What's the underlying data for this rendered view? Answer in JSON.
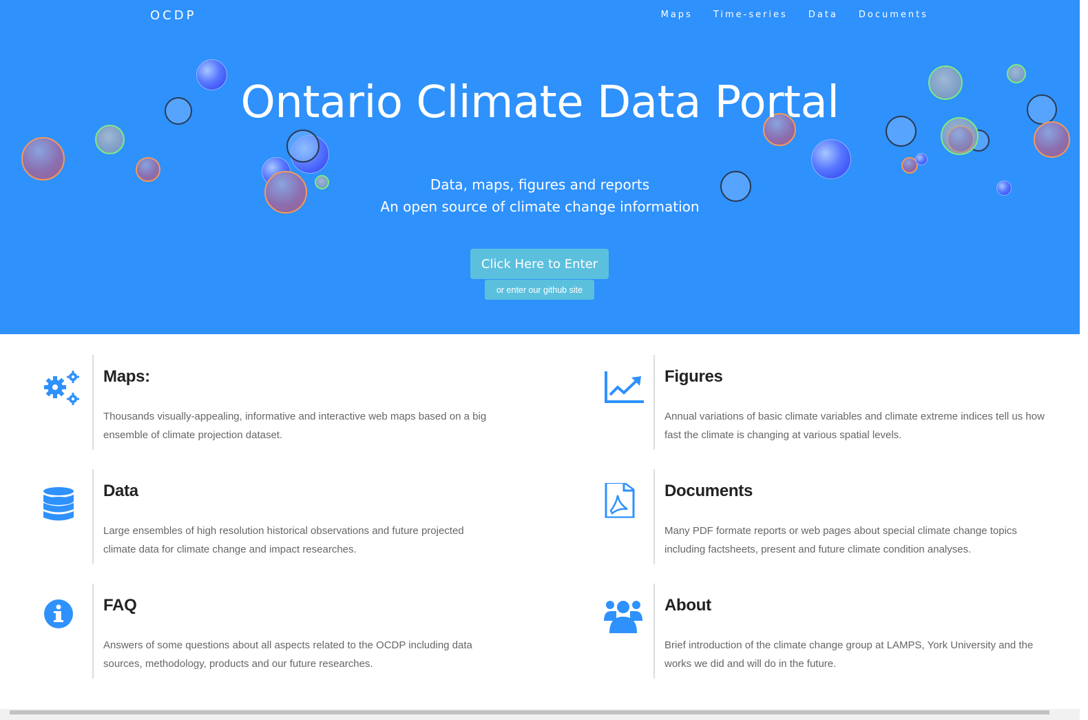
{
  "header": {
    "brand": "OCDP",
    "nav": [
      "Maps",
      "Time-series",
      "Data",
      "Documents"
    ]
  },
  "hero": {
    "title": "Ontario Climate Data Portal",
    "subtitle_1": "Data, maps, figures and reports",
    "subtitle_2": "An open source of climate change information",
    "enter_button": "Click Here to Enter",
    "github_button": "or enter our github site"
  },
  "features": [
    {
      "title": "Maps:",
      "icon": "gears-icon",
      "text": "Thousands visually-appealing, informative and interactive web maps based on a big ensemble of climate projection dataset."
    },
    {
      "title": "Figures",
      "icon": "line-chart-icon",
      "text": "Annual variations of basic climate variables and climate extreme indices tell us how fast the climate is changing at various spatial levels."
    },
    {
      "title": "Data",
      "icon": "database-icon",
      "text": "Large ensembles of high resolution historical observations and future projected climate data for climate change and impact researches."
    },
    {
      "title": "Documents",
      "icon": "pdf-file-icon",
      "text": "Many PDF formate reports or web pages about special climate change topics including factsheets, present and future climate condition analyses."
    },
    {
      "title": "FAQ",
      "icon": "info-circle-icon",
      "text": "Answers of some questions about all aspects related to the OCDP including data sources, methodology, products and our future researches."
    },
    {
      "title": "About",
      "icon": "users-icon",
      "text": "Brief introduction of the climate change group at LAMPS, York University and the works we did and will do in the future."
    }
  ],
  "colors": {
    "hero": "#2e91fc",
    "accent": "#2e91fc",
    "button": "#5bc0de"
  }
}
